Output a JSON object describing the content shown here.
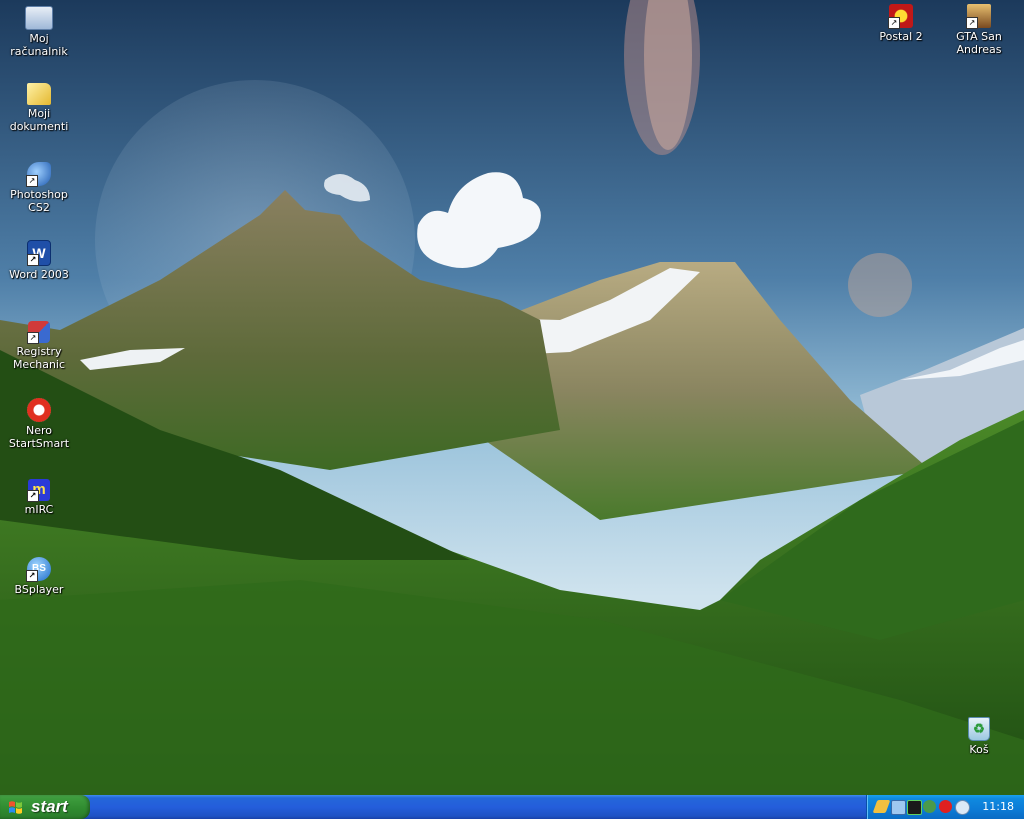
{
  "desktop": {
    "icons_left": [
      {
        "label": "Moj računalnik",
        "icon": "my-computer-icon",
        "shortcut": false
      },
      {
        "label": "Moji dokumenti",
        "icon": "my-documents-icon",
        "shortcut": false
      },
      {
        "label": "Photoshop CS2",
        "icon": "photoshop-icon",
        "shortcut": true
      },
      {
        "label": "Word 2003",
        "icon": "word-icon",
        "shortcut": true
      },
      {
        "label": "Registry Mechanic",
        "icon": "registry-mechanic-icon",
        "shortcut": true
      },
      {
        "label": "Nero StartSmart",
        "icon": "nero-icon",
        "shortcut": true
      },
      {
        "label": "mIRC",
        "icon": "mirc-icon",
        "shortcut": true
      },
      {
        "label": "BSplayer",
        "icon": "bsplayer-icon",
        "shortcut": true
      }
    ],
    "icons_right": [
      {
        "label": "Postal 2",
        "icon": "postal2-icon",
        "shortcut": true
      },
      {
        "label": "GTA San Andreas",
        "icon": "gta-san-andreas-icon",
        "shortcut": true
      }
    ],
    "recycle_bin": {
      "label": "Koš",
      "icon": "recycle-bin-icon"
    }
  },
  "taskbar": {
    "start_label": "start",
    "clock": "11:18",
    "colors": {
      "taskbar_blue": "#245edb",
      "start_green": "#3c9b3c",
      "tray_blue": "#0c7bd6"
    }
  }
}
